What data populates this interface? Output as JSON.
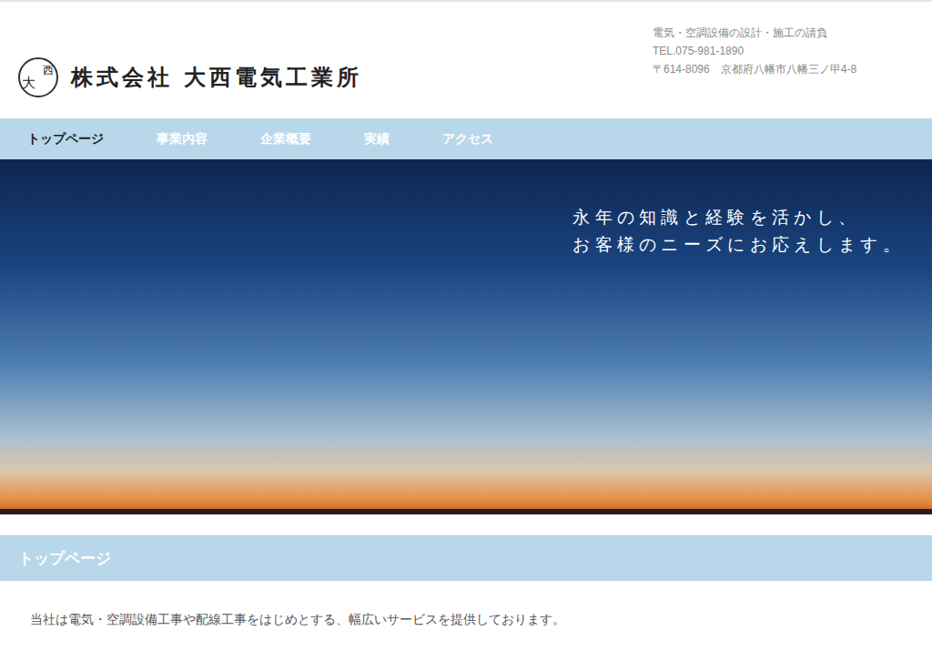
{
  "header": {
    "logo": {
      "mark": [
        "大",
        "西"
      ],
      "name": "株式会社 大西電気工業所"
    },
    "info": [
      "電気・空調設備の設計・施工の請負",
      "TEL.075-981-1890",
      "〒614-8096　京都府八幡市八幡三ノ甲4-8"
    ]
  },
  "nav": [
    {
      "label": "トップページ",
      "selected": true
    },
    {
      "label": "事業内容",
      "selected": false
    },
    {
      "label": "企業概要",
      "selected": false
    },
    {
      "label": "実績",
      "selected": false
    },
    {
      "label": "アクセス",
      "selected": false
    }
  ],
  "hero": {
    "slogan": [
      "永年の知識と経験を活かし、",
      "お客様のニーズにお応えします。"
    ]
  },
  "section": {
    "title": "トップページ",
    "paragraphs": [
      "当社は電気・空調設備工事や配線工事をはじめとする、幅広いサービスを提供しております。"
    ]
  }
}
